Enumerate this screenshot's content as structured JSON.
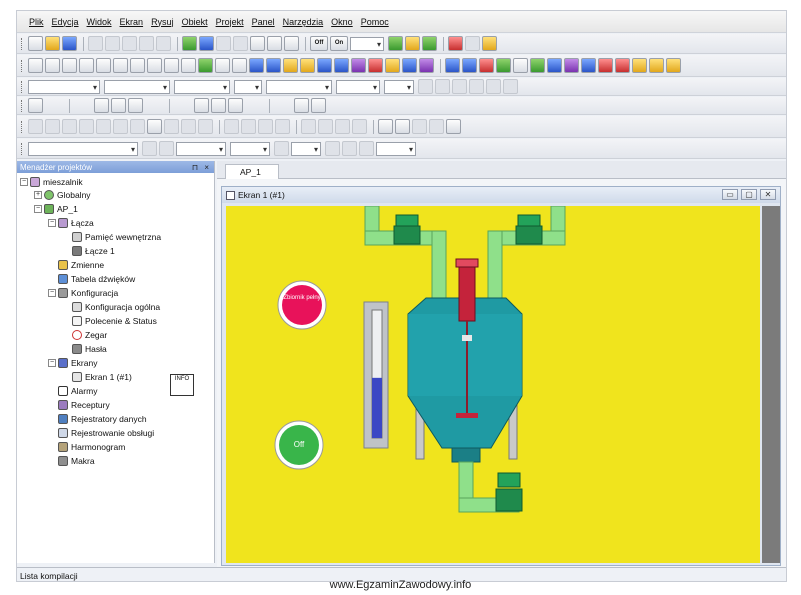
{
  "menu": [
    "Plik",
    "Edycja",
    "Widok",
    "Ekran",
    "Rysuj",
    "Obiekt",
    "Projekt",
    "Panel",
    "Narzędzia",
    "Okno",
    "Pomoc"
  ],
  "toolbar": {
    "off_label": "Off",
    "on_label": "On"
  },
  "project_manager": {
    "title": "Menadżer projektów",
    "controls": "⊓ ×",
    "tree": [
      "mieszalnik",
      "Globalny",
      "AP_1",
      "Łącza",
      "Pamięć wewnętrzna",
      "Łącze 1",
      "Zmienne",
      "Tabela dźwięków",
      "Konfiguracja",
      "Konfiguracja ogólna",
      "Polecenie & Status",
      "Zegar",
      "Hasła",
      "Ekrany",
      "Ekran 1 (#1)",
      "Alarmy",
      "Receptury",
      "Rejestratory danych",
      "Rejestrowanie obsługi",
      "Harmonogram",
      "Makra"
    ]
  },
  "doc_tab": "AP_1",
  "screen_window": {
    "title": "Ekran 1 (#1)",
    "buttons": [
      "▭",
      "▢",
      "✕"
    ],
    "alarm_lamp_label": "Zbiornik pełny",
    "switch_label": "Off",
    "level_fraction": 0.47,
    "colors": {
      "background": "#f0e41d",
      "alarm_lamp": "#e8125a",
      "switch": "#39b54a",
      "tank": "#1f9aa3",
      "pipe": "#8fe08a",
      "level_fill": "#3b47c4"
    }
  },
  "file_icon_label": "INFO",
  "status_bar": "Lista kompilacji",
  "watermark": "www.EgzaminZawodowy.info"
}
